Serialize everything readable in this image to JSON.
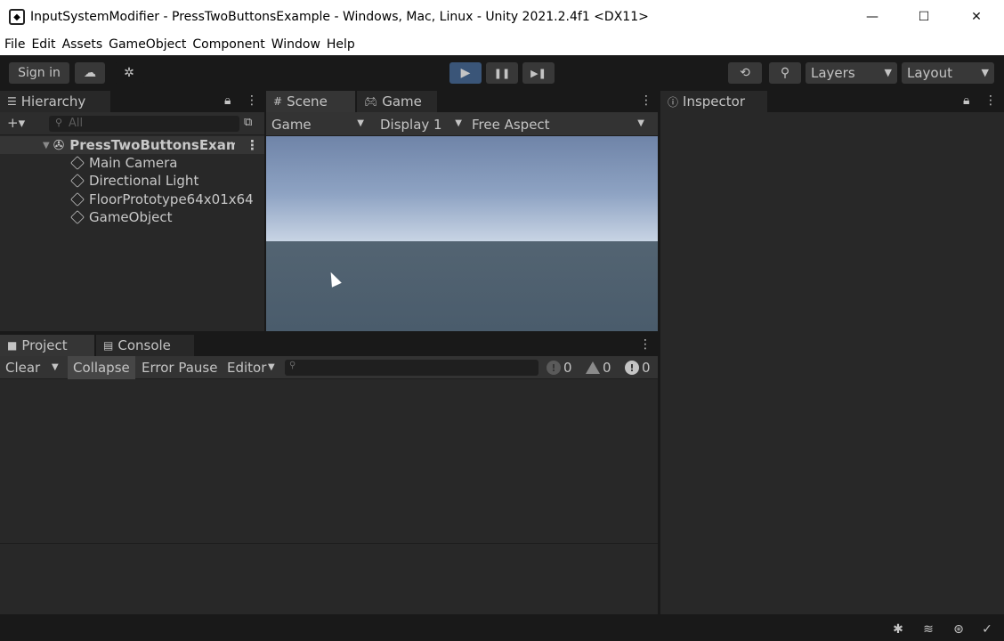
{
  "window": {
    "title": "InputSystemModifier - PressTwoButtonsExample - Windows, Mac, Linux - Unity 2021.2.4f1 <DX11>",
    "minimize_glyph": "—",
    "maximize_glyph": "☐",
    "close_glyph": "✕"
  },
  "menu": [
    "File",
    "Edit",
    "Assets",
    "GameObject",
    "Component",
    "Window",
    "Help"
  ],
  "toolbar": {
    "sign_in": "Sign in",
    "layers": "Layers",
    "layout": "Layout",
    "play_glyph": "▶",
    "pause_glyph": "❚❚",
    "step_glyph": "▶❚"
  },
  "hierarchy": {
    "tab": "Hierarchy",
    "add_glyph": "+▾",
    "search_placeholder": "All",
    "scene": "PressTwoButtonsExamp",
    "items": [
      "Main Camera",
      "Directional Light",
      "FloorPrototype64x01x64",
      "GameObject"
    ]
  },
  "scene_tab": "Scene",
  "game": {
    "tab": "Game",
    "view_drop": "Game",
    "display": "Display 1",
    "aspect": "Free Aspect"
  },
  "inspector": {
    "tab": "Inspector"
  },
  "project_tab": "Project",
  "console": {
    "tab": "Console",
    "clear": "Clear",
    "collapse": "Collapse",
    "error_pause": "Error Pause",
    "editor": "Editor",
    "info_count": "0",
    "warn_count": "0",
    "error_count": "0"
  },
  "colors": {
    "play_active": "#3a5578",
    "panel_bg": "#282828",
    "chrome_bg": "#191919"
  }
}
